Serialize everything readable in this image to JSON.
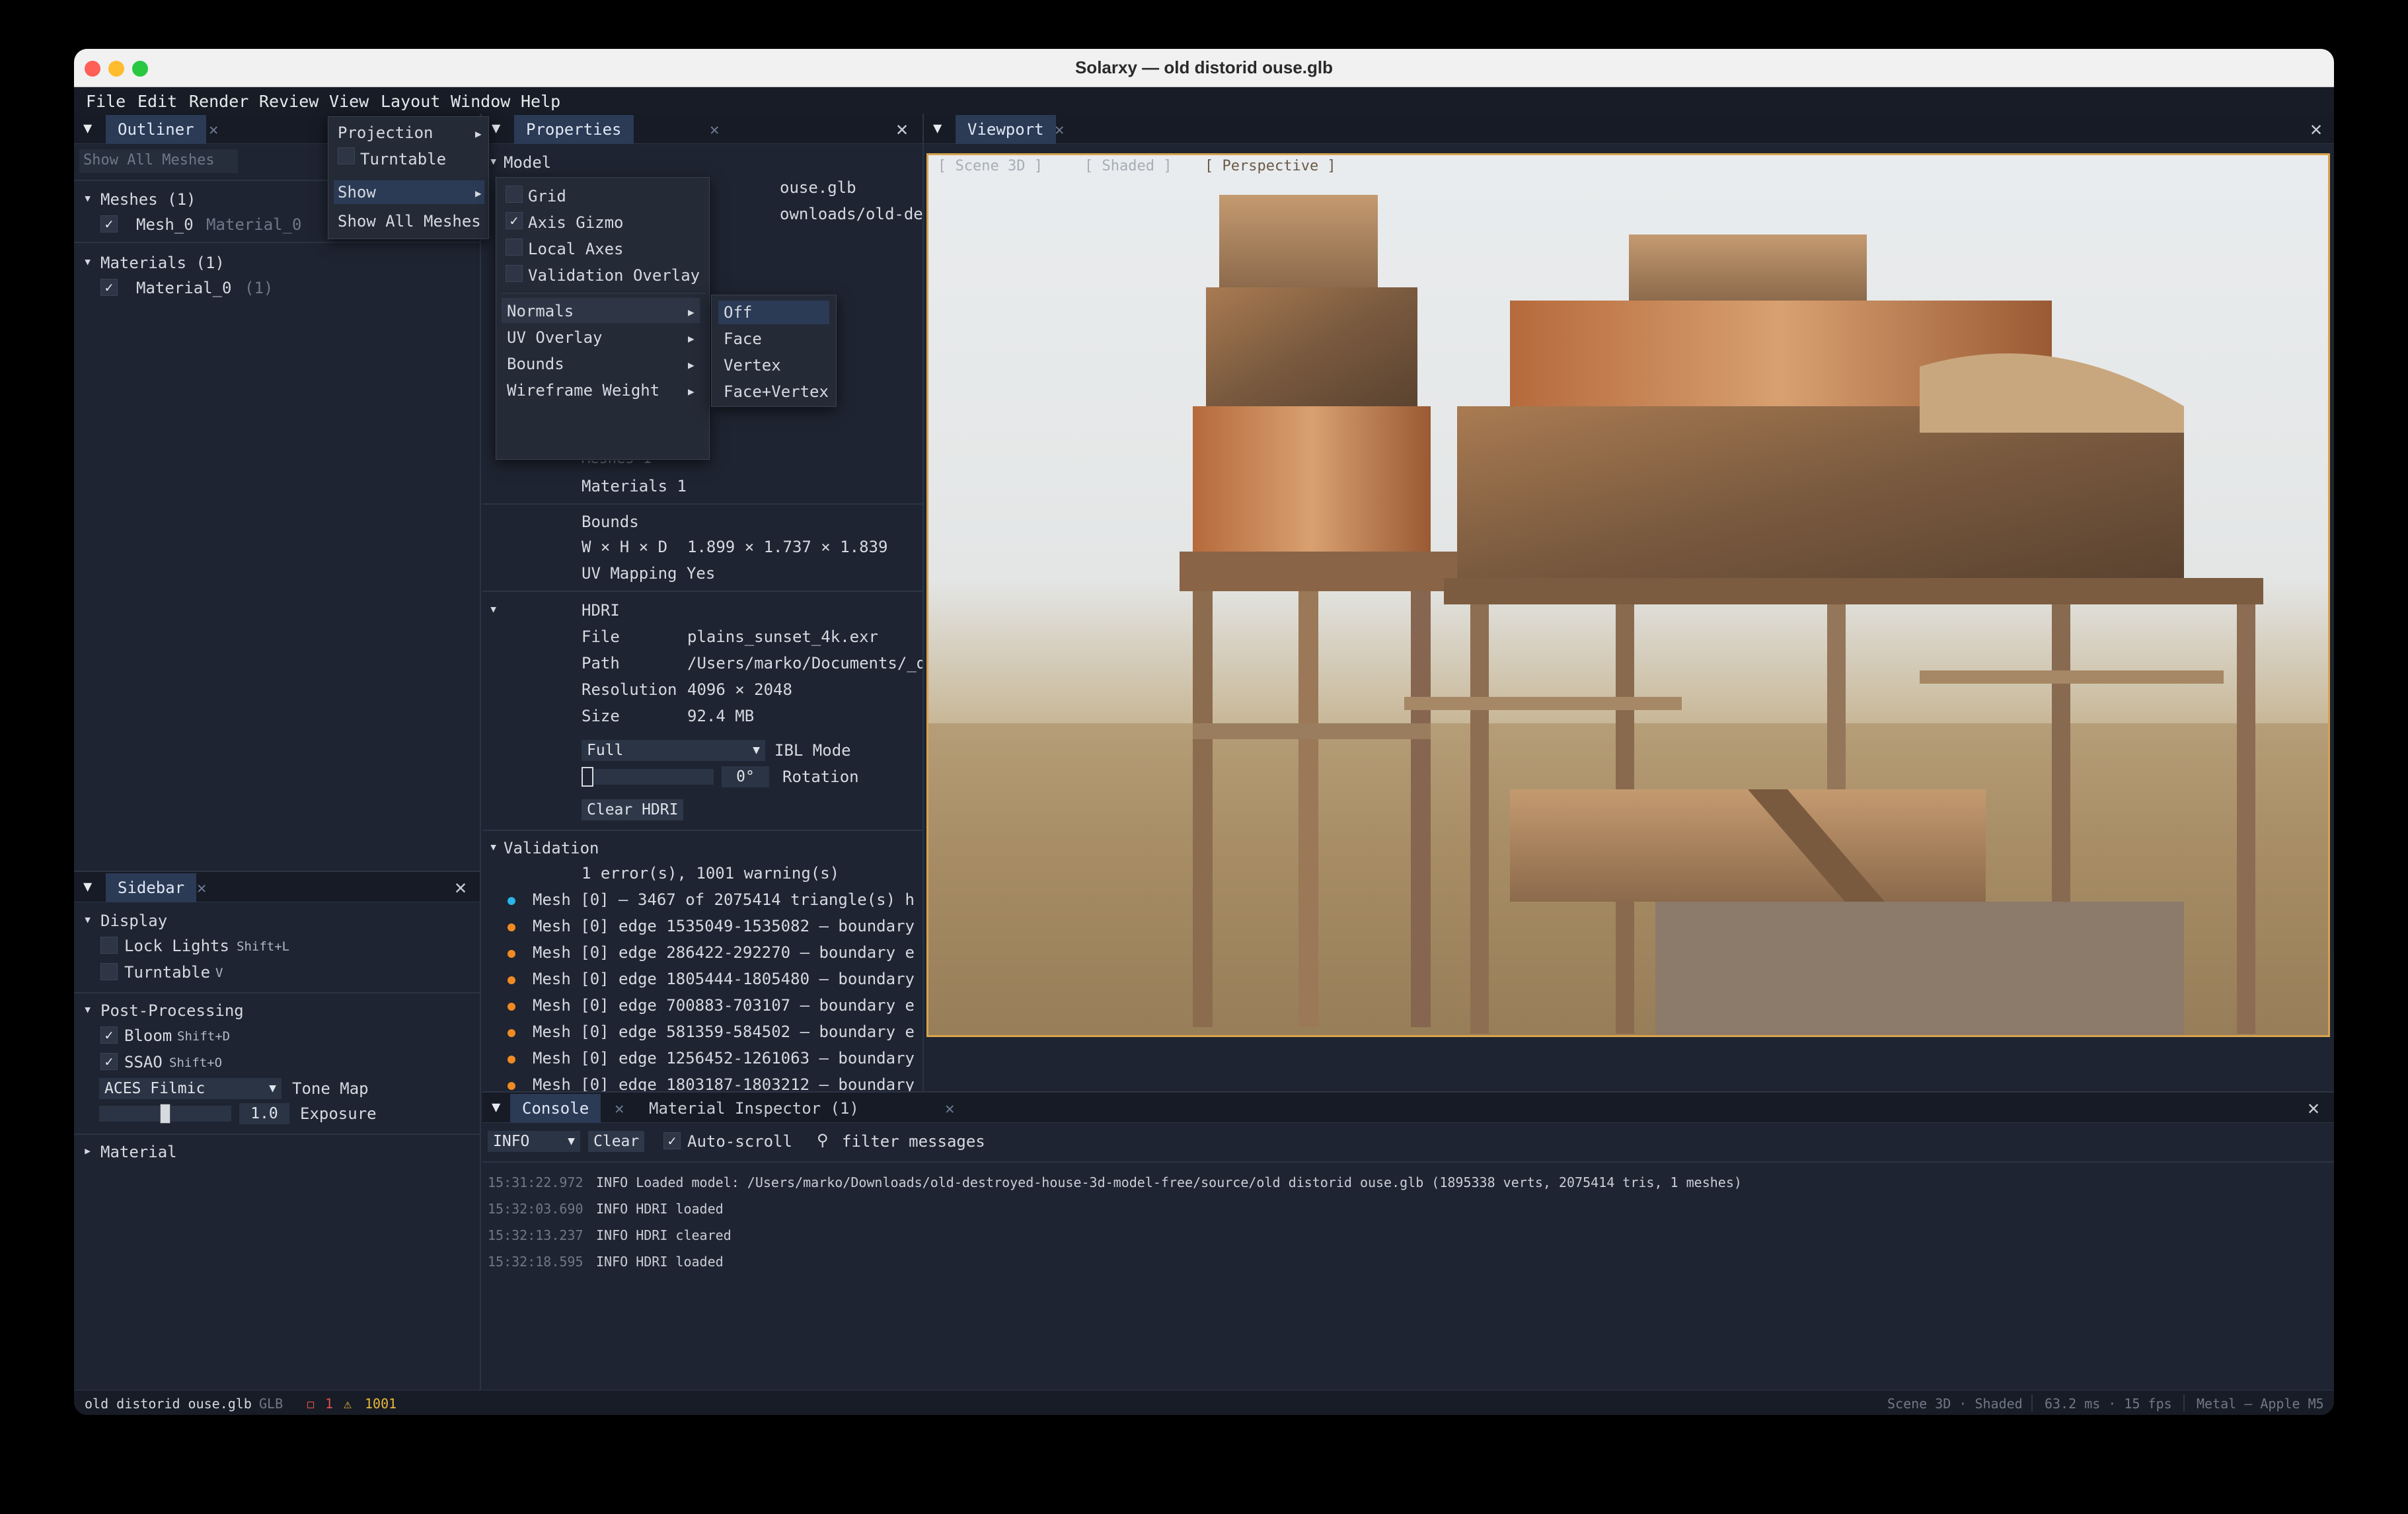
{
  "window": {
    "title": "Solarxy — old distorid ouse.glb"
  },
  "menubar": [
    "File",
    "Edit",
    "Render",
    "Review",
    "View",
    "Layout",
    "Window",
    "Help"
  ],
  "outliner": {
    "tab": "Outliner",
    "filter_placeholder": "Show All Meshes",
    "meshes_header": "Meshes (1)",
    "mesh_name": "Mesh_0",
    "mesh_material": "Material_0",
    "materials_header": "Materials (1)",
    "material_name": "Material_0",
    "material_count": "(1)"
  },
  "layout_menu": {
    "projection": "Projection",
    "turntable": "Turntable",
    "show": "Show",
    "show_all_meshes": "Show All Meshes"
  },
  "show_menu": {
    "grid": "Grid",
    "axis_gizmo": "Axis Gizmo",
    "local_axes": "Local Axes",
    "validation_overlay": "Validation Overlay",
    "normals": "Normals",
    "uv_overlay": "UV Overlay",
    "bounds": "Bounds",
    "wireframe_weight": "Wireframe Weight"
  },
  "normals_menu": [
    "Off",
    "Face",
    "Vertex",
    "Face+Vertex"
  ],
  "properties": {
    "tab": "Properties",
    "model_header": "Model",
    "file_partial": "ouse.glb",
    "path_partial": "ownloads/old-destroyed",
    "meshes_partial": "Meshes   1",
    "materials_row": "Materials 1",
    "bounds_label": "Bounds",
    "whd_label": "W × H × D",
    "whd_value": "1.899 × 1.737 × 1.839",
    "uv_mapping": "UV Mapping Yes",
    "hdri_header": "HDRI",
    "hdri_rows": [
      {
        "k": "File",
        "v": "plains_sunset_4k.exr"
      },
      {
        "k": "Path",
        "v": "/Users/marko/Documents/_dev/_cg_"
      },
      {
        "k": "Resolution",
        "v": "4096 × 2048"
      },
      {
        "k": "Size",
        "v": "92.4 MB"
      }
    ],
    "ibl_mode_value": "Full",
    "ibl_mode_label": "IBL Mode",
    "rotation_value": "0°",
    "rotation_label": "Rotation",
    "rotation_fraction": 0.0,
    "clear_hdri": "Clear HDRI",
    "validation_header": "Validation",
    "validation_summary": "1 error(s), 1001 warning(s)",
    "validation_items": [
      {
        "kind": "info",
        "text": "Mesh [0] — 3467 of 2075414 triangle(s) h"
      },
      {
        "kind": "warn",
        "text": "Mesh [0] edge 1535049-1535082 — boundary"
      },
      {
        "kind": "warn",
        "text": "Mesh [0] edge 286422-292270 — boundary e"
      },
      {
        "kind": "warn",
        "text": "Mesh [0] edge 1805444-1805480 — boundary"
      },
      {
        "kind": "warn",
        "text": "Mesh [0] edge 700883-703107 — boundary e"
      },
      {
        "kind": "warn",
        "text": "Mesh [0] edge 581359-584502 — boundary e"
      },
      {
        "kind": "warn",
        "text": "Mesh [0] edge 1256452-1261063 — boundary"
      },
      {
        "kind": "warn",
        "text": "Mesh [0] edge 1803187-1803212 — boundary"
      }
    ],
    "colors": {
      "info": "#2ab4e8",
      "warn": "#f08a24"
    }
  },
  "viewport": {
    "tab": "Viewport",
    "overlay_labels": [
      "[ Scene 3D ]",
      "[ Shaded ]",
      "[ Perspective ]"
    ]
  },
  "sidebar": {
    "tab": "Sidebar",
    "display_header": "Display",
    "lock_lights": "Lock Lights",
    "lock_lights_key": "Shift+L",
    "turntable": "Turntable",
    "turntable_key": "V",
    "post_header": "Post-Processing",
    "bloom": "Bloom",
    "bloom_key": "Shift+D",
    "ssao": "SSAO",
    "ssao_key": "Shift+O",
    "tonemap_value": "ACES Filmic",
    "tonemap_label": "Tone Map",
    "exposure_value": "1.0",
    "exposure_label": "Exposure",
    "exposure_fraction": 0.5,
    "material_header": "Material"
  },
  "console": {
    "tab": "Console",
    "tab2": "Material Inspector (1)",
    "level": "INFO",
    "clear": "Clear",
    "autoscroll": "Auto-scroll",
    "filter_placeholder": "filter messages",
    "logs": [
      {
        "time": "15:31:22.972",
        "msg": "INFO Loaded model: /Users/marko/Downloads/old-destroyed-house-3d-model-free/source/old distorid ouse.glb (1895338 verts, 2075414 tris, 1 meshes)"
      },
      {
        "time": "15:32:03.690",
        "msg": "INFO HDRI loaded"
      },
      {
        "time": "15:32:13.237",
        "msg": "INFO HDRI cleared"
      },
      {
        "time": "15:32:18.595",
        "msg": "INFO HDRI loaded"
      }
    ]
  },
  "statusbar": {
    "file": "old distorid ouse.glb",
    "format": "GLB",
    "errors": "1",
    "warnings": "1001",
    "mode": "Scene 3D · Shaded",
    "perf": "63.2 ms · 15 fps",
    "gpu": "Metal — Apple M5"
  }
}
